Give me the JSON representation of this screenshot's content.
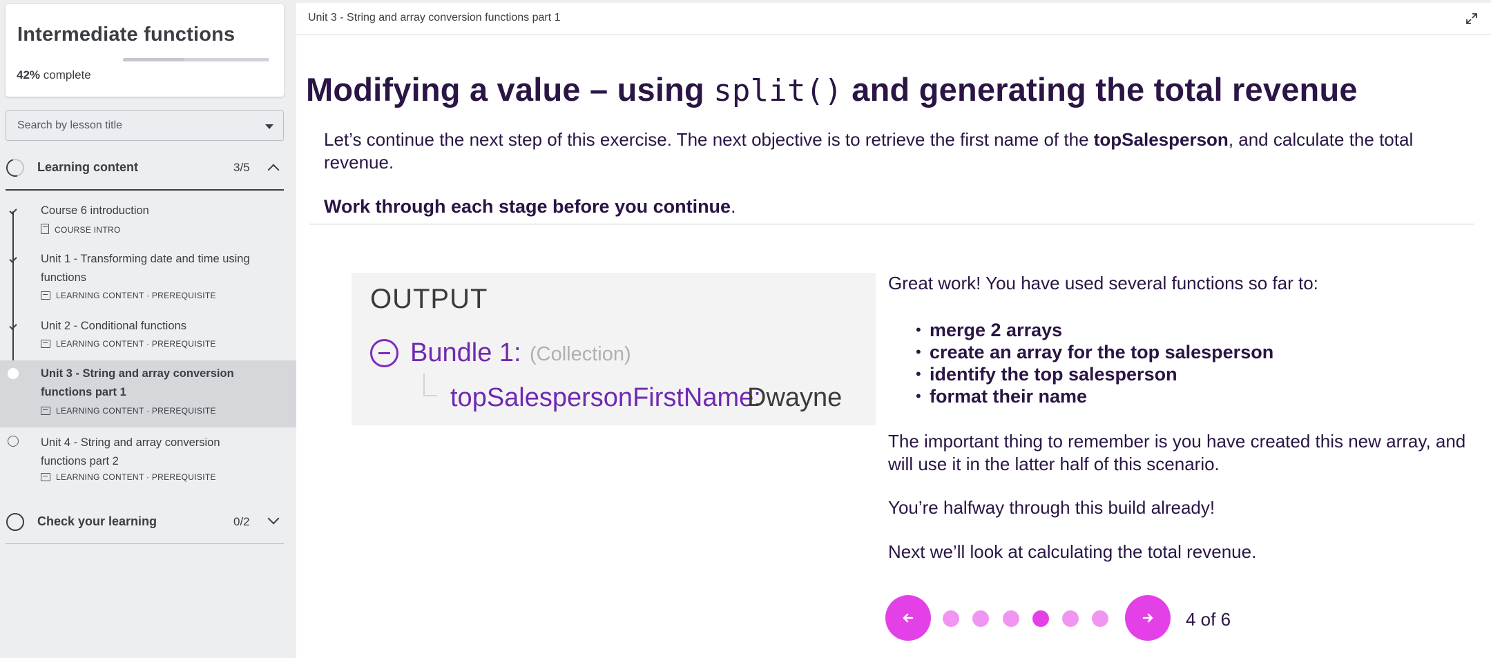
{
  "sidebar": {
    "course_title": "Intermediate functions",
    "progress_percent": 42,
    "progress_value": "42%",
    "progress_suffix": "complete",
    "search_placeholder": "Search by lesson title",
    "sections": [
      {
        "label": "Learning content",
        "count": "3/5",
        "expanded": true,
        "lessons": [
          {
            "title": "Course 6 introduction",
            "meta": "COURSE INTRO",
            "status": "done",
            "icon": "document-icon"
          },
          {
            "title": "Unit 1 - Transforming date and time using functions",
            "meta": "LEARNING CONTENT · PREREQUISITE",
            "status": "done",
            "icon": "slides-icon"
          },
          {
            "title": "Unit 2 - Conditional functions",
            "meta": "LEARNING CONTENT · PREREQUISITE",
            "status": "done",
            "icon": "slides-icon"
          },
          {
            "title": "Unit 3 - String and array conversion functions part 1",
            "meta": "LEARNING CONTENT · PREREQUISITE",
            "status": "current",
            "icon": "slides-icon"
          },
          {
            "title": "Unit 4 - String and array conversion functions part 2",
            "meta": "LEARNING CONTENT · PREREQUISITE",
            "status": "not-started",
            "icon": "slides-icon"
          }
        ]
      },
      {
        "label": "Check your learning",
        "count": "0/2",
        "expanded": false
      }
    ]
  },
  "main": {
    "unit_title": "Unit 3 - String and array conversion functions part 1",
    "heading_pre": "Modifying a value – using ",
    "heading_code": "split()",
    "heading_post": " and generating the total revenue",
    "intro_pre": "Let’s continue the next step of this exercise. The next objective is to retrieve the first name of the ",
    "intro_bold": "topSalesperson",
    "intro_post": ", and calculate the total revenue.",
    "stage_note": "Work through each stage before you continue",
    "stage_note_end": ".",
    "output": {
      "label": "OUTPUT",
      "bundle_label": "Bundle 1:",
      "bundle_type": "(Collection)",
      "field_label": "topSalespersonFirstName:",
      "field_value": "Dwayne"
    },
    "summary_intro": "Great work! You have used several functions so far to:",
    "bullets": [
      "merge 2 arrays",
      "create an array for the top salesperson",
      "identify the top salesperson",
      "format their name"
    ],
    "important_text": "The important thing to remember is you have created this new array, and will use it in the latter half of this scenario.",
    "halfway_text": "You’re halfway through this build already!",
    "next_text": "Next we’ll look at calculating the total revenue.",
    "pager": {
      "current": 4,
      "total": 6,
      "label": "4 of 6"
    }
  },
  "colors": {
    "accent_magenta": "#e440e8",
    "accent_magenta_light": "#f096f2",
    "heading_purple": "#2a1545",
    "output_purple": "#6f2ab0"
  }
}
